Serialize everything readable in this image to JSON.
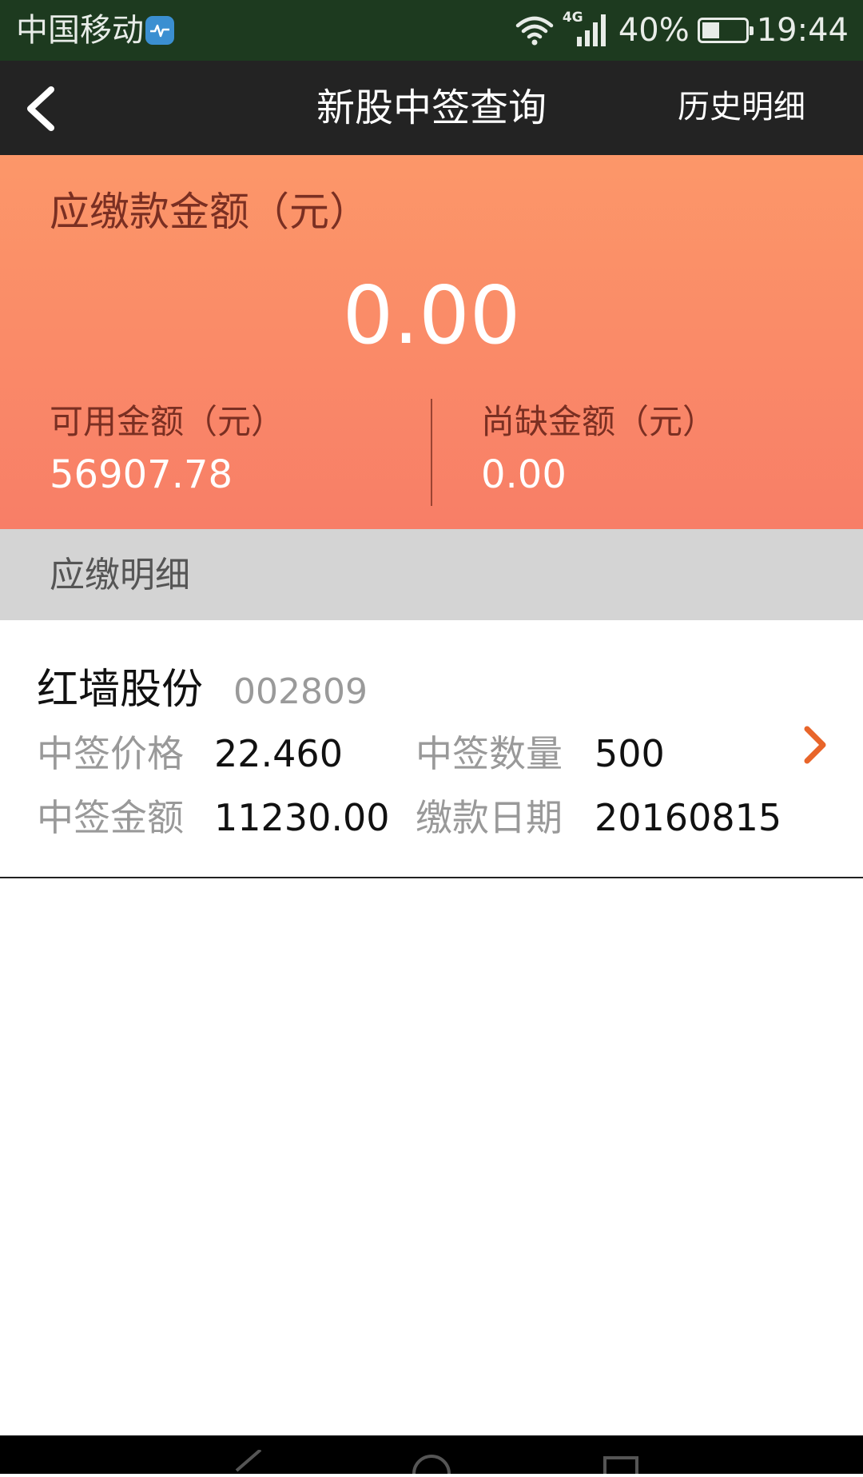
{
  "status_bar": {
    "carrier": "中国移动",
    "network": "4G",
    "battery": "40%",
    "battery_level": 0.4,
    "time": "19:44"
  },
  "header": {
    "title": "新股中签查询",
    "history_link": "历史明细"
  },
  "summary": {
    "due_label": "应缴款金额（元）",
    "due_amount": "0.00",
    "available_label": "可用金额（元）",
    "available_value": "56907.78",
    "shortfall_label": "尚缺金额（元）",
    "shortfall_value": "0.00"
  },
  "section": {
    "title": "应缴明细"
  },
  "items": [
    {
      "name": "红墙股份",
      "code": "002809",
      "price_label": "中签价格",
      "price": "22.460",
      "qty_label": "中签数量",
      "qty": "500",
      "amount_label": "中签金额",
      "amount": "11230.00",
      "date_label": "缴款日期",
      "date": "20160815"
    }
  ],
  "colors": {
    "summary_top": "#fc9769",
    "summary_bottom": "#f87e67",
    "accent_chevron": "#e8652a",
    "header_bg": "#232323",
    "status_bg": "#1d3a1f"
  },
  "icons": {
    "back": "chevron-left-icon",
    "row_arrow": "chevron-right-icon",
    "wifi": "wifi-icon",
    "signal": "signal-icon",
    "battery": "battery-icon"
  }
}
